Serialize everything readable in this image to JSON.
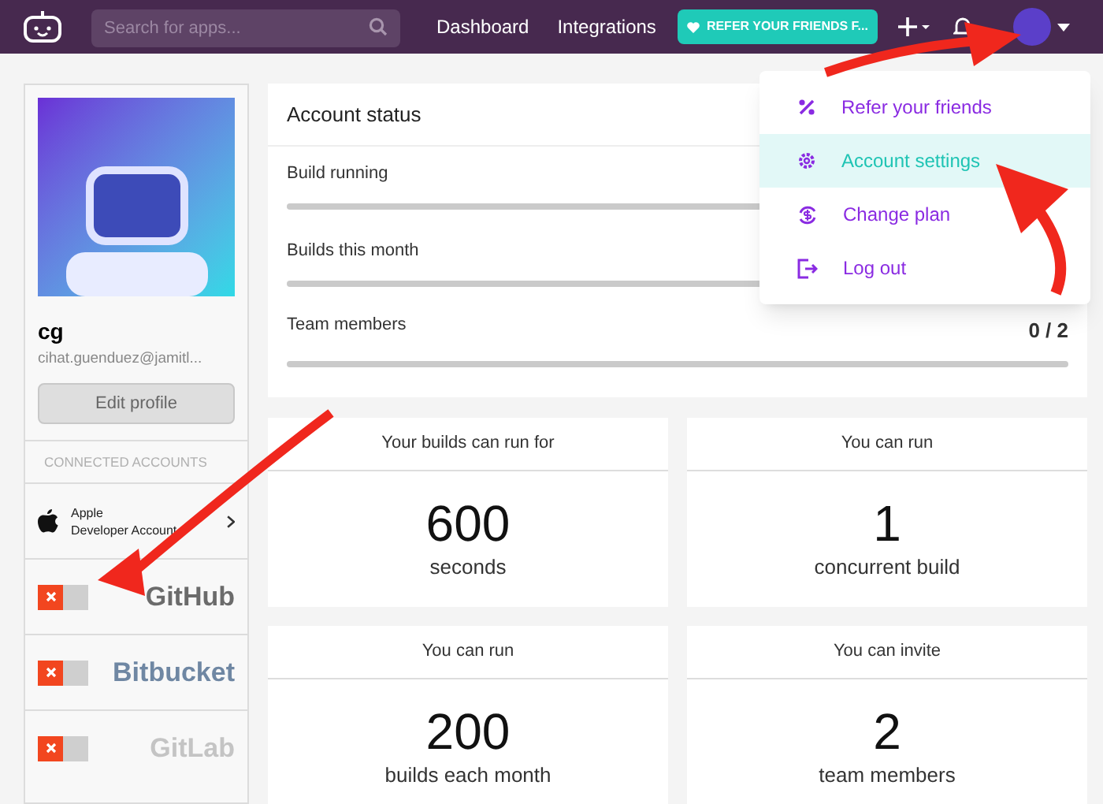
{
  "topbar": {
    "search": {
      "placeholder": "Search for apps..."
    },
    "nav": [
      {
        "label": "Dashboard"
      },
      {
        "label": "Integrations"
      }
    ],
    "refer_button": "REFER YOUR FRIENDS F..."
  },
  "profile": {
    "username": "cg",
    "email": "cihat.guenduez@jamitl...",
    "edit_button": "Edit profile",
    "connected_heading": "CONNECTED ACCOUNTS",
    "apple": {
      "line1": "Apple",
      "line2": "Developer Account"
    },
    "accounts": [
      {
        "name": "GitHub",
        "connected": false,
        "color": "#6b6b6b"
      },
      {
        "name": "Bitbucket",
        "connected": false,
        "color": "#6f87a3"
      },
      {
        "name": "GitLab",
        "connected": false,
        "color": "#c4c4c4"
      }
    ]
  },
  "account_status": {
    "title": "Account status",
    "rows": [
      {
        "label": "Build running",
        "level": 0
      },
      {
        "label": "Builds this month",
        "level": 0
      },
      {
        "label": "Team members",
        "level": 0,
        "reading": "0 / 2"
      }
    ]
  },
  "stats": [
    {
      "heading": "Your builds can run for",
      "value": "600",
      "unit": "seconds"
    },
    {
      "heading": "You can run",
      "value": "1",
      "unit": "concurrent build"
    },
    {
      "heading": "You can run",
      "value": "200",
      "unit": "builds each month"
    },
    {
      "heading": "You can invite",
      "value": "2",
      "unit": "team members"
    }
  ],
  "menu": [
    {
      "kind": "percent",
      "label": "Refer your friends",
      "selected": false
    },
    {
      "kind": "gear",
      "label": "Account settings",
      "selected": true
    },
    {
      "kind": "exchange",
      "label": "Change plan",
      "selected": false
    },
    {
      "kind": "logout",
      "label": "Log out",
      "selected": false
    }
  ]
}
